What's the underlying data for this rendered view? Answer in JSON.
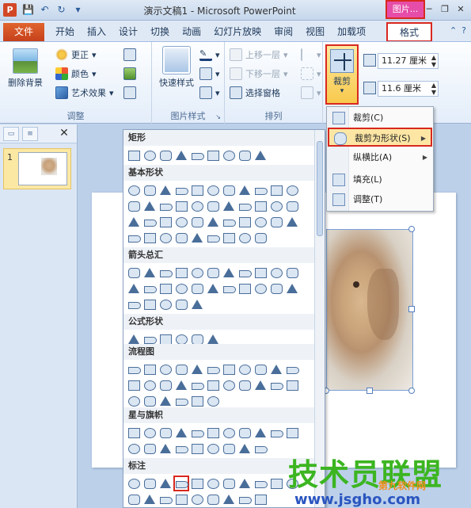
{
  "titlebar": {
    "title": "演示文稿1 - Microsoft PowerPoint",
    "context_badge": "图片...",
    "app_letter": "P"
  },
  "tabs": {
    "file": "文件",
    "items": [
      "开始",
      "插入",
      "设计",
      "切换",
      "动画",
      "幻灯片放映",
      "审阅",
      "视图",
      "加载项"
    ],
    "format": "格式"
  },
  "ribbon": {
    "remove_bg": "删除背景",
    "adjust": {
      "corrections": "更正",
      "color": "颜色",
      "artistic": "艺术效果",
      "label": "调整"
    },
    "styles": {
      "quick_styles": "快速样式",
      "label": "图片样式"
    },
    "arrange": {
      "bring_forward": "上移一层",
      "send_backward": "下移一层",
      "selection_pane": "选择窗格",
      "label": "排列"
    },
    "size": {
      "crop": "裁剪",
      "height": "11.27 厘米",
      "width": "11.6 厘米"
    }
  },
  "crop_menu": {
    "items": [
      {
        "label": "裁剪(C)",
        "arrow": ""
      },
      {
        "label": "裁剪为形状(S)",
        "arrow": "▶"
      },
      {
        "label": "纵横比(A)",
        "arrow": "▶"
      },
      {
        "label": "填充(L)",
        "arrow": ""
      },
      {
        "label": "调整(T)",
        "arrow": ""
      }
    ]
  },
  "slides_pane": {
    "slide_number": "1"
  },
  "gallery": {
    "sections": [
      {
        "title": "矩形",
        "count": 9
      },
      {
        "title": "基本形状",
        "count": 42
      },
      {
        "title": "箭头总汇",
        "count": 27
      },
      {
        "title": "公式形状",
        "count": 6
      },
      {
        "title": "流程图",
        "count": 28
      },
      {
        "title": "星与旗帜",
        "count": 20
      },
      {
        "title": "标注",
        "count": 20
      }
    ]
  },
  "watermark": {
    "main": "技术员联盟",
    "small": "第九软件网",
    "url": "www.jsgho.com"
  },
  "colors": {
    "accent_red": "#d8281f",
    "file_tab": "#d24726",
    "context_pink": "#e64da8",
    "highlight_yellow": "#fde6a4"
  }
}
